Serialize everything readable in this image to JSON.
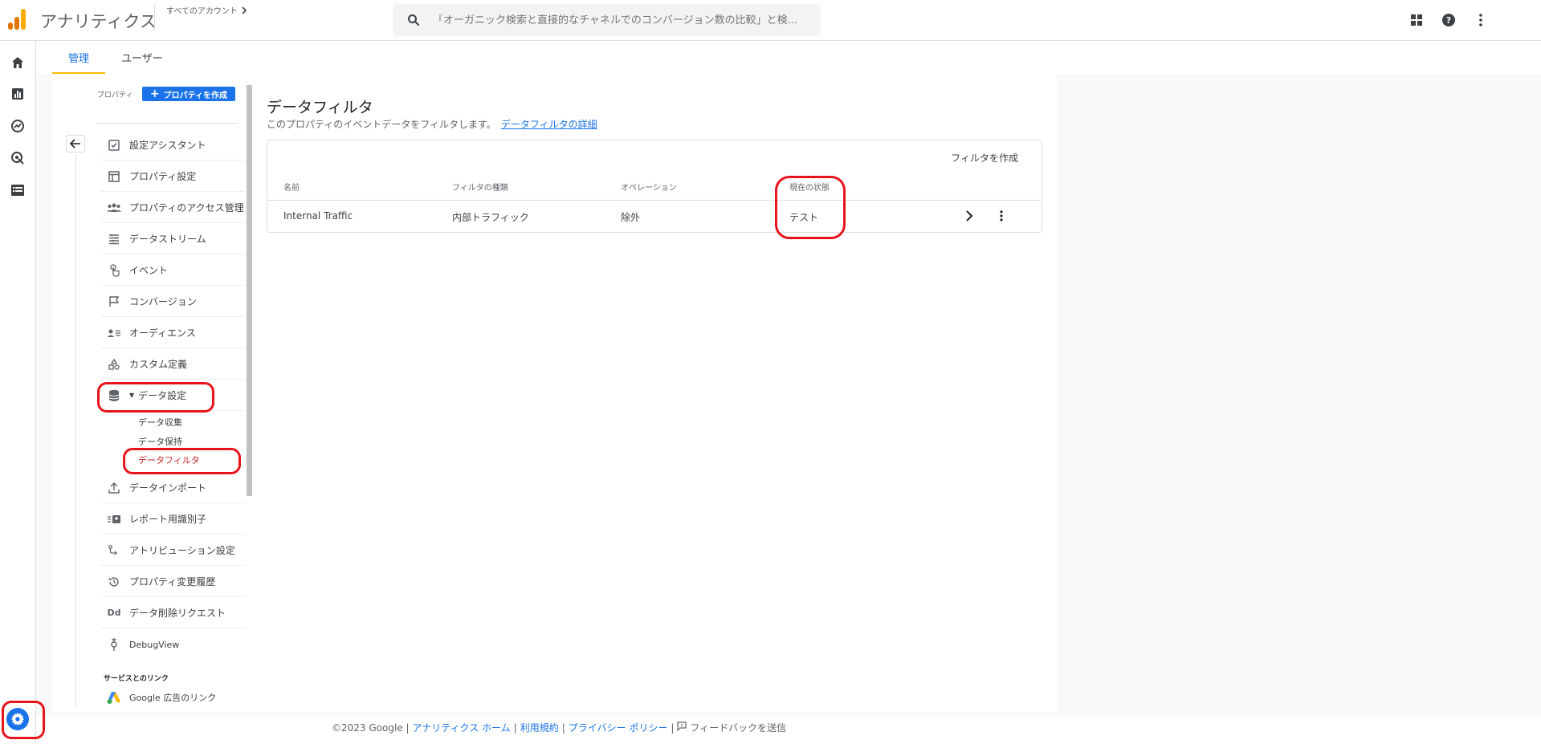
{
  "header": {
    "app_title": "アナリティクス",
    "account_crumb": "すべてのアカウント",
    "search_placeholder": "「オーガニック検索と直接的なチャネルでのコンバージョン数の比較」と検...",
    "logo_colors": [
      "#f9ab00",
      "#e37400",
      "#e37400"
    ]
  },
  "tabs": [
    {
      "label": "管理",
      "active": true
    },
    {
      "label": "ユーザー",
      "active": false
    }
  ],
  "nav": {
    "property_label": "プロパティ",
    "create_property_label": "プロパティを作成",
    "items": [
      {
        "label": "設定アシスタント",
        "icon": "checkbox-icon"
      },
      {
        "label": "プロパティ設定",
        "icon": "layout-icon"
      },
      {
        "label": "プロパティのアクセス管理",
        "icon": "people-icon"
      },
      {
        "label": "データストリーム",
        "icon": "streams-icon"
      },
      {
        "label": "イベント",
        "icon": "touch-icon"
      },
      {
        "label": "コンバージョン",
        "icon": "flag-icon"
      },
      {
        "label": "オーディエンス",
        "icon": "audience-icon"
      },
      {
        "label": "カスタム定義",
        "icon": "shapes-icon"
      },
      {
        "label": "データ設定",
        "icon": "database-icon",
        "expanded": true
      },
      {
        "label": "データインポート",
        "icon": "upload-icon"
      },
      {
        "label": "レポート用識別子",
        "icon": "identity-icon"
      },
      {
        "label": "アトリビューション設定",
        "icon": "attribution-icon"
      },
      {
        "label": "プロパティ変更履歴",
        "icon": "history-icon"
      },
      {
        "label": "データ削除リクエスト",
        "icon": "dd-icon",
        "icon_text": "Dd"
      },
      {
        "label": "DebugView",
        "icon": "debug-icon"
      }
    ],
    "sub_items": [
      {
        "label": "データ収集",
        "active": false
      },
      {
        "label": "データ保持",
        "active": false
      },
      {
        "label": "データフィルタ",
        "active": true
      }
    ],
    "services_label": "サービスとのリンク",
    "google_ads_link": "Google 広告のリンク"
  },
  "main": {
    "title": "データフィルタ",
    "description": "このプロパティのイベントデータをフィルタします。",
    "detail_link": "データフィルタの詳細",
    "create_filter_label": "フィルタを作成",
    "columns": [
      "名前",
      "フィルタの種類",
      "オペレーション",
      "現在の状態"
    ],
    "rows": [
      {
        "name": "Internal Traffic",
        "type": "内部トラフィック",
        "operation": "除外",
        "state": "テスト"
      }
    ]
  },
  "footer": {
    "copyright": "©2023 Google |",
    "links": [
      "アナリティクス ホーム",
      "利用規約",
      "プライバシー ポリシー"
    ],
    "sep": "|",
    "feedback": "フィードバックを送信"
  },
  "colors": {
    "accent": "#1a73e8",
    "annotation": "#e8141b",
    "active_sub": "#c5221f"
  }
}
